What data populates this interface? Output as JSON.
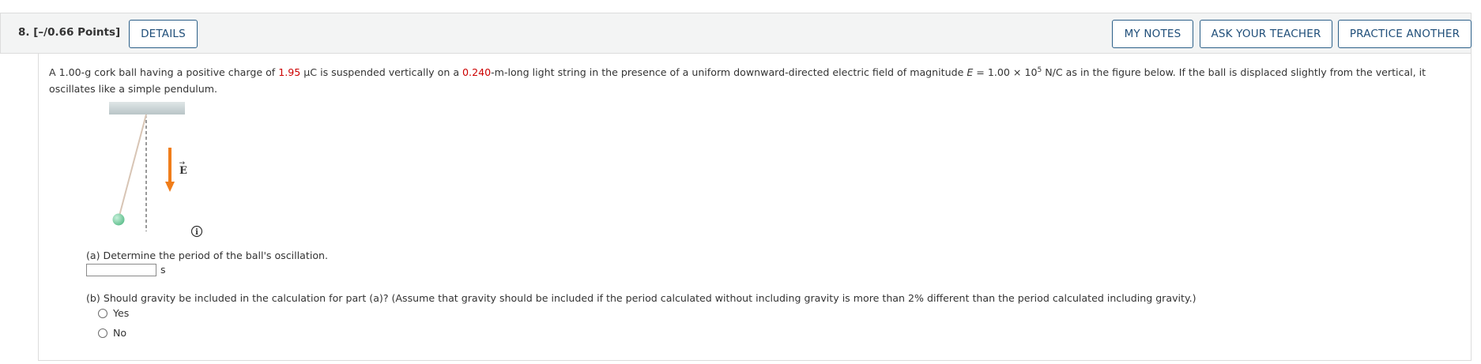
{
  "header": {
    "question_number": "8.",
    "points": "[–/0.66 Points]",
    "details_label": "DETAILS",
    "my_notes_label": "MY NOTES",
    "ask_teacher_label": "ASK YOUR TEACHER",
    "practice_label": "PRACTICE ANOTHER"
  },
  "problem": {
    "t1": "A 1.00-g cork ball having a positive charge of ",
    "charge": "1.95",
    "t2": " μC is suspended vertically on a ",
    "length": "0.240",
    "t3": "-m-long light string in the presence of a uniform downward-directed electric field of magnitude ",
    "e_symbol": "E",
    "t4": " = 1.00 × 10",
    "exponent": "5",
    "t5": " N/C as in the figure below. If the ball is displaced slightly from the vertical, it oscillates like a simple pendulum."
  },
  "figure": {
    "field_label": "E",
    "field_arrow": "→",
    "info_icon_label": "i",
    "colors": {
      "arrow": "#f07d1a",
      "ball": "#7ccfa5",
      "ceiling": "#cdd6d8"
    }
  },
  "part_a": {
    "question": "(a) Determine the period of the ball's oscillation.",
    "value": "",
    "unit": "s"
  },
  "part_b": {
    "question": "(b) Should gravity be included in the calculation for part (a)? (Assume that gravity should be included if the period calculated without including gravity is more than 2% different than the period calculated including gravity.)",
    "options": [
      "Yes",
      "No"
    ]
  }
}
